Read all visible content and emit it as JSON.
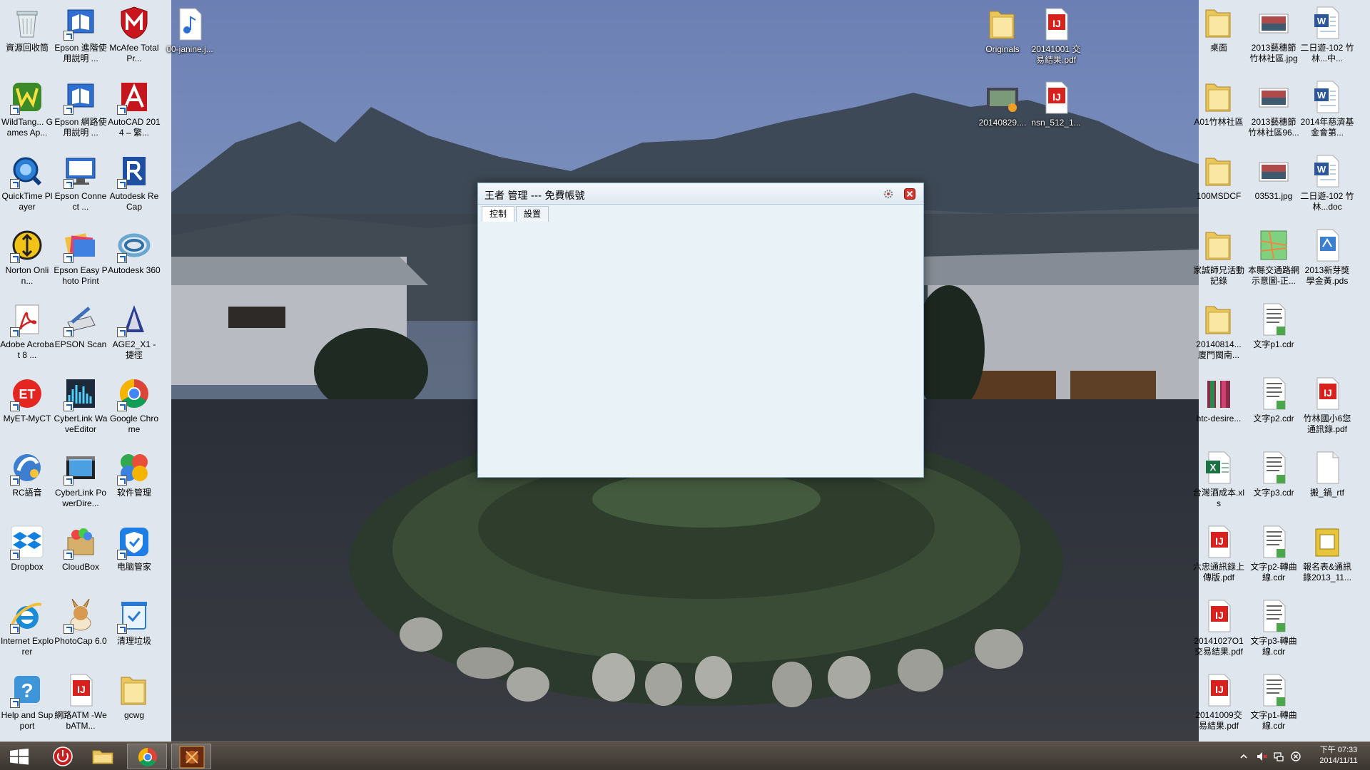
{
  "window": {
    "title": "王者 管理 --- 免費帳號",
    "tabs": [
      {
        "label": "控制",
        "active": true
      },
      {
        "label": "設置",
        "active": false
      }
    ]
  },
  "desktop_icons_left": [
    {
      "label": "資源回收筒",
      "icon": "recycle-bin-icon"
    },
    {
      "label": "Epson 進階使用說明 ...",
      "icon": "epson-manual-icon"
    },
    {
      "label": "McAfee Total Pr...",
      "icon": "mcafee-icon"
    },
    {
      "label": "WildTang... Games Ap...",
      "icon": "wildtangent-icon"
    },
    {
      "label": "Epson 網路使用說明 ...",
      "icon": "epson-manual-icon"
    },
    {
      "label": "AutoCAD 2014 – 繁...",
      "icon": "autocad-icon"
    },
    {
      "label": "QuickTime Player",
      "icon": "quicktime-icon"
    },
    {
      "label": "Epson Connect ...",
      "icon": "epson-connect-icon"
    },
    {
      "label": "Autodesk ReCap",
      "icon": "recap-icon"
    },
    {
      "label": "Norton Onlin...",
      "icon": "norton-icon"
    },
    {
      "label": "Epson Easy Photo Print",
      "icon": "epson-photo-icon"
    },
    {
      "label": "Autodesk 360",
      "icon": "autodesk360-icon"
    },
    {
      "label": "Adobe Acrobat 8 ...",
      "icon": "acrobat-icon"
    },
    {
      "label": "EPSON Scan",
      "icon": "epson-scan-icon"
    },
    {
      "label": "AGE2_X1 - 捷徑",
      "icon": "age-icon"
    },
    {
      "label": "MyET-MyCT",
      "icon": "myet-icon"
    },
    {
      "label": "CyberLink WaveEditor",
      "icon": "waveeditor-icon"
    },
    {
      "label": "Google Chrome",
      "icon": "chrome-icon"
    },
    {
      "label": "RC語音",
      "icon": "rc-voice-icon"
    },
    {
      "label": "CyberLink PowerDire...",
      "icon": "powerdirector-icon"
    },
    {
      "label": "软件管理",
      "icon": "software-manager-icon"
    },
    {
      "label": "Dropbox",
      "icon": "dropbox-icon"
    },
    {
      "label": "CloudBox",
      "icon": "cloudbox-icon"
    },
    {
      "label": "电脑管家",
      "icon": "pc-manager-icon"
    },
    {
      "label": "Internet Explorer",
      "icon": "ie-icon"
    },
    {
      "label": "PhotoCap 6.0",
      "icon": "photocap-icon"
    },
    {
      "label": "清理垃圾",
      "icon": "cleanup-icon"
    },
    {
      "label": "Help and Support",
      "icon": "help-icon"
    },
    {
      "label": "網路ATM -WebATM...",
      "icon": "pdf-icon"
    },
    {
      "label": "gcwg",
      "icon": "folder-icon"
    }
  ],
  "desktop_icons_mid": [
    {
      "label": "00-janine.j...",
      "icon": "audio-file-icon"
    },
    {
      "label": "Originals",
      "icon": "folder-icon"
    },
    {
      "label": "20141001 交易結果.pdf",
      "icon": "pdf-icon"
    },
    {
      "label": "20140829....",
      "icon": "video-file-icon"
    },
    {
      "label": "nsn_512_1...",
      "icon": "pdf-icon"
    }
  ],
  "desktop_icons_right": [
    {
      "label": "桌面",
      "icon": "folder-icon"
    },
    {
      "label": "2013藝穗節 竹林社區.jpg",
      "icon": "image-file-icon"
    },
    {
      "label": "二日遊-102 竹林...中...",
      "icon": "word-file-icon"
    },
    {
      "label": "A01竹林社區",
      "icon": "folder-icon"
    },
    {
      "label": "2013藝穗節 竹林社區96...",
      "icon": "image-file-icon"
    },
    {
      "label": "2014年慈濟基金會第...",
      "icon": "word-file-icon"
    },
    {
      "label": "100MSDCF",
      "icon": "folder-icon"
    },
    {
      "label": "03531.jpg",
      "icon": "image-file-icon"
    },
    {
      "label": "二日遊-102 竹林...doc",
      "icon": "word-file-icon"
    },
    {
      "label": "家誠師兄活動記錄",
      "icon": "folder-icon"
    },
    {
      "label": "本縣交通路網示意圖-正...",
      "icon": "map-file-icon"
    },
    {
      "label": "2013新芽獎 學金黃.pds",
      "icon": "pds-file-icon"
    },
    {
      "label": "20140814... 廈門閩南...",
      "icon": "folder-icon"
    },
    {
      "label": "文字p1.cdr",
      "icon": "cdr-file-icon"
    },
    {
      "label": "htc-desire...",
      "icon": "rar-file-icon"
    },
    {
      "label": "文字p2.cdr",
      "icon": "cdr-file-icon"
    },
    {
      "label": "竹林國小6您通訊錄.pdf",
      "icon": "pdf-icon"
    },
    {
      "label": "台灣酒成本.xls",
      "icon": "excel-file-icon"
    },
    {
      "label": "文字p3.cdr",
      "icon": "cdr-file-icon"
    },
    {
      "label": "搬_鍋_rtf",
      "icon": "blank-file-icon"
    },
    {
      "label": "六忠通訊錄上傳版.pdf",
      "icon": "pdf-icon"
    },
    {
      "label": "文字p2-轉曲線.cdr",
      "icon": "cdr-file-icon"
    },
    {
      "label": "報名表&通訊錄2013_11...",
      "icon": "archive-file-icon"
    },
    {
      "label": "20141027O1 交易結果.pdf",
      "icon": "pdf-icon"
    },
    {
      "label": "文字p3-轉曲線.cdr",
      "icon": "cdr-file-icon"
    },
    {
      "label": "20141009交易結果.pdf",
      "icon": "pdf-icon"
    },
    {
      "label": "文字p1-轉曲線.cdr",
      "icon": "cdr-file-icon"
    }
  ],
  "taskbar": {
    "buttons": [
      {
        "name": "start-button",
        "icon": "windows-logo-icon"
      },
      {
        "name": "shutdown-app-button",
        "icon": "power-icon"
      },
      {
        "name": "file-explorer-button",
        "icon": "folder-icon"
      },
      {
        "name": "chrome-taskbar-button",
        "icon": "chrome-icon"
      },
      {
        "name": "game-taskbar-button",
        "icon": "game-app-icon"
      }
    ],
    "clock": {
      "time": "下午 07:33",
      "date": "2014/11/11"
    }
  }
}
